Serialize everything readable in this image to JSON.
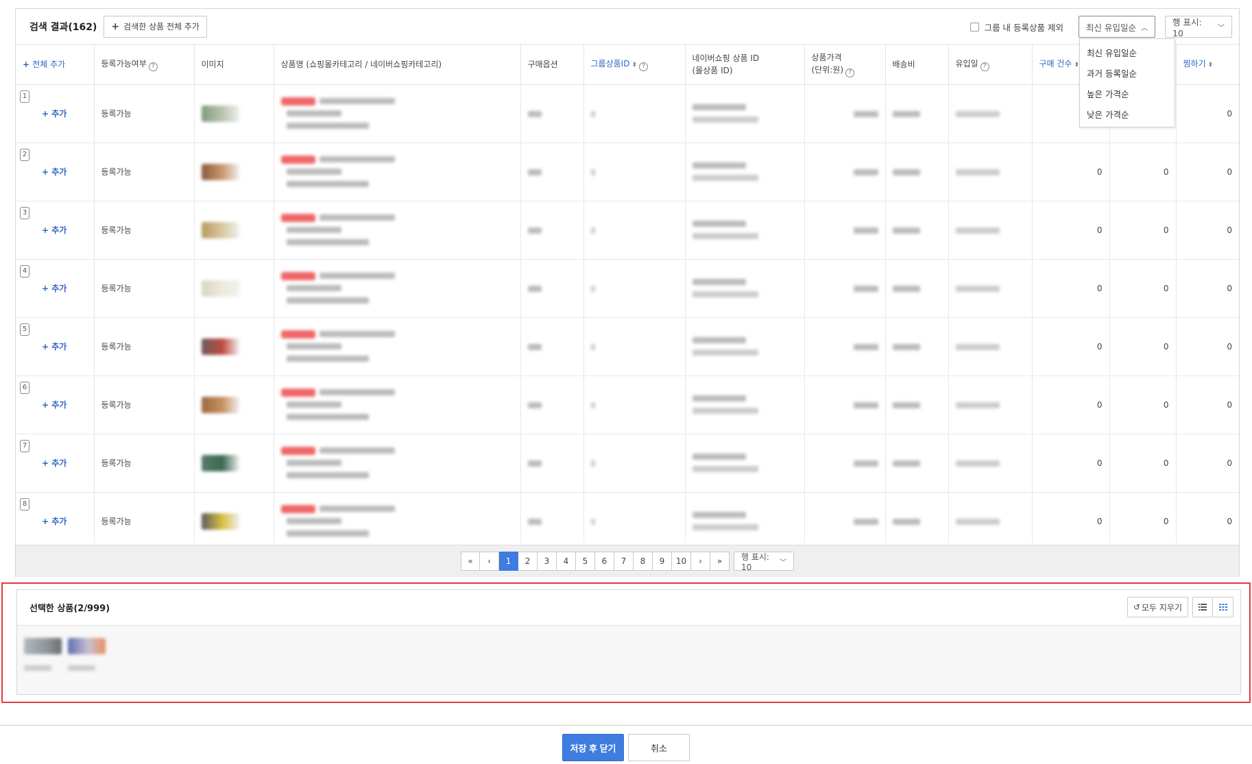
{
  "results": {
    "title": "검색 결과(162)",
    "add_all_label": "검색한 상품 전체 추가",
    "exclude_label": "그룹 내 등록상품 제외",
    "sort_selected": "최신 유입일순",
    "rows_selected": "행 표시: 10",
    "sort_options": [
      "최신 유입일순",
      "과거 등록일순",
      "높은 가격순",
      "낮은 가격순"
    ]
  },
  "table": {
    "headers": {
      "add_all": "전체 추가",
      "registrable": "등록가능여부",
      "image": "이미지",
      "product_name": "상품명 (쇼핑몰카테고리 / 네이버쇼핑카테고리)",
      "purchase_option": "구매옵션",
      "group_id": "그룹상품ID",
      "naver_id_1": "네이버쇼핑 상품 ID",
      "naver_id_2": "(몰상품 ID)",
      "price_1": "상품가격",
      "price_2": "(단위:원)",
      "shipping": "배송비",
      "inflow_date": "유입일",
      "purchase_count": "구매 건수",
      "col_hidden": "",
      "wishlist": "찜하기"
    },
    "rows": [
      {
        "num": "1",
        "add": "추가",
        "status": "등록가능",
        "c1": "",
        "c2": "",
        "c3": "0"
      },
      {
        "num": "2",
        "add": "추가",
        "status": "등록가능",
        "c1": "0",
        "c2": "0",
        "c3": "0"
      },
      {
        "num": "3",
        "add": "추가",
        "status": "등록가능",
        "c1": "0",
        "c2": "0",
        "c3": "0"
      },
      {
        "num": "4",
        "add": "추가",
        "status": "등록가능",
        "c1": "0",
        "c2": "0",
        "c3": "0"
      },
      {
        "num": "5",
        "add": "추가",
        "status": "등록가능",
        "c1": "0",
        "c2": "0",
        "c3": "0"
      },
      {
        "num": "6",
        "add": "추가",
        "status": "등록가능",
        "c1": "0",
        "c2": "0",
        "c3": "0"
      },
      {
        "num": "7",
        "add": "추가",
        "status": "등록가능",
        "c1": "0",
        "c2": "0",
        "c3": "0"
      },
      {
        "num": "8",
        "add": "추가",
        "status": "등록가능",
        "c1": "0",
        "c2": "0",
        "c3": "0"
      }
    ]
  },
  "pagination": {
    "first": "«",
    "prev": "‹",
    "pages": [
      "1",
      "2",
      "3",
      "4",
      "5",
      "6",
      "7",
      "8",
      "9",
      "10"
    ],
    "current": "1",
    "next": "›",
    "last": "»",
    "rows_label": "행 표시: 10"
  },
  "selected": {
    "title": "선택한 상품(2/999)",
    "clear_label": "모두 지우기"
  },
  "footer": {
    "save_label": "저장 후 닫기",
    "cancel_label": "취소"
  },
  "colors": {
    "accent": "#3f7ce0",
    "link": "#2f63c8",
    "highlight_border": "#e23a3a"
  }
}
